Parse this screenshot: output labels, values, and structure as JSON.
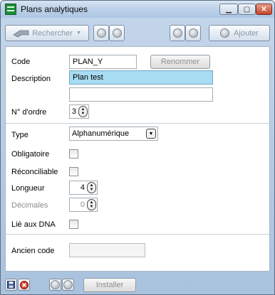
{
  "window": {
    "title": "Plans analytiques"
  },
  "toolbar": {
    "search_label": "Rechercher",
    "add_label": "Ajouter"
  },
  "form": {
    "code_label": "Code",
    "code_value": "PLAN_Y",
    "rename_label": "Renommer",
    "description_label": "Description",
    "description_value": "Plan test",
    "description2_value": "",
    "order_label": "N° d'ordre",
    "order_value": "3",
    "type_label": "Type",
    "type_value": "Alphanumérique",
    "mandatory_label": "Obligatoire",
    "reconcilable_label": "Réconciliable",
    "length_label": "Longueur",
    "length_value": "4",
    "decimals_label": "Décimales",
    "decimals_value": "0",
    "dna_label": "Lié aux DNA",
    "old_code_label": "Ancien code",
    "old_code_value": ""
  },
  "statusbar": {
    "install_label": "Installer"
  },
  "colors": {
    "active_field": "#a8dcf2",
    "close_button": "#c7432b",
    "app_icon": "#1e8c3a"
  },
  "icons": [
    "app-icon",
    "minimize-icon",
    "maximize-icon",
    "close-icon",
    "search-icon",
    "prev-icon",
    "next-icon",
    "first-icon",
    "last-icon",
    "add-icon",
    "save-icon",
    "cancel-icon",
    "dropdown-arrow-icon",
    "spinner-arrows-icon"
  ]
}
